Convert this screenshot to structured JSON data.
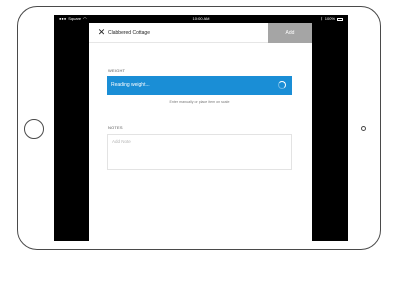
{
  "status_bar": {
    "carrier": "Square",
    "time": "10:00 AM",
    "battery": "100%"
  },
  "header": {
    "title": "Clabbered Cottage",
    "add_label": "Add"
  },
  "weight": {
    "section_label": "WEIGHT",
    "status_text": "Reading weight...",
    "hint": "Enter manually or place item on scale"
  },
  "notes": {
    "section_label": "NOTES",
    "placeholder": "Add Note",
    "value": ""
  },
  "colors": {
    "accent": "#1a8ed6",
    "add_button_bg": "#a5a5a5"
  }
}
